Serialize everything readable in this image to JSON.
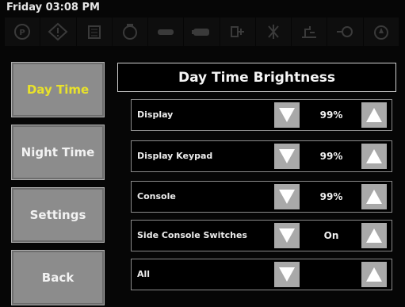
{
  "status_bar": {
    "time": "Friday 03:08 PM"
  },
  "warning_icons": [
    "parking-brake-icon",
    "general-warning-icon",
    "filter-icon",
    "engine-icon",
    "hydraulic-icon",
    "battery-icon",
    "transmission-icon",
    "coolant-icon",
    "oil-pressure-icon",
    "fuel-icon",
    "water-icon"
  ],
  "sidebar": {
    "day_time": "Day Time",
    "night_time": "Night Time",
    "settings": "Settings",
    "back": "Back"
  },
  "panel": {
    "title": "Day Time Brightness",
    "rows": [
      {
        "label": "Display",
        "value": "99%"
      },
      {
        "label": "Display Keypad",
        "value": "99%"
      },
      {
        "label": "Console",
        "value": "99%"
      },
      {
        "label": "Side Console Switches",
        "value": "On"
      },
      {
        "label": "All",
        "value": ""
      }
    ]
  },
  "colors": {
    "active_text": "#e9e22a",
    "button_gray": "#8c8c8c",
    "arrow_white": "#ffffff"
  }
}
